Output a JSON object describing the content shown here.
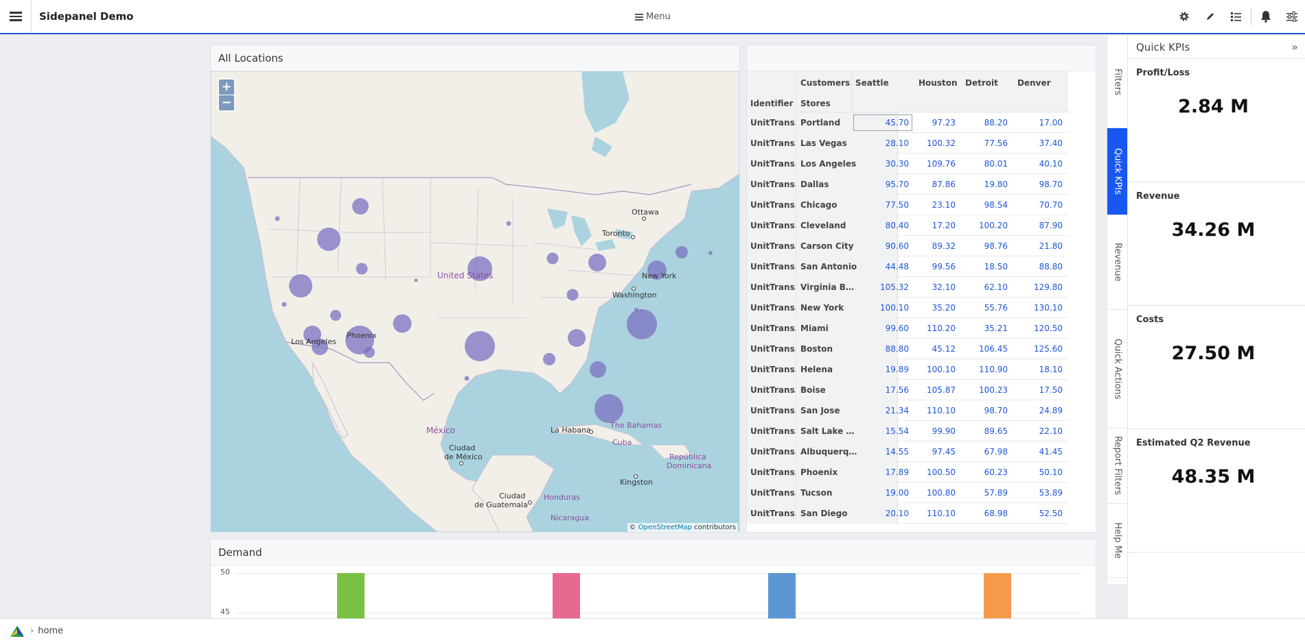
{
  "header": {
    "app_title": "Sidepanel Demo",
    "menu_label": "Menu",
    "icons": [
      "hamburger-icon",
      "gear-icon",
      "pencil-icon",
      "list-icon",
      "bell-icon",
      "sliders-icon"
    ]
  },
  "map_panel": {
    "title": "All Locations",
    "zoom_in": "+",
    "zoom_out": "−",
    "attribution_prefix": "© ",
    "attribution_link": "OpenStreetMap",
    "attribution_suffix": " contributors",
    "labels": {
      "united_states": "United States",
      "mexico": "México",
      "ciudad": "Ciudad",
      "de_mexico": "de México",
      "ottawa": "Ottawa",
      "toronto": "Toronto",
      "washington": "Washington",
      "new_york": "New York",
      "los_angeles": "Los Angeles",
      "phoenix": "Phoenix",
      "la_habana": "La Habana",
      "bahamas": "The Bahamas",
      "cuba": "Cuba",
      "republica": "República",
      "dominicana": "Dominicana",
      "kingston": "Kingston",
      "ciudad2": "Ciudad",
      "guatemala": "de Guatemala",
      "honduras": "Honduras",
      "nicaragua": "Nicaragua"
    }
  },
  "table": {
    "header_row1": "Customers",
    "header_identifier": "Identifier",
    "header_stores": "Stores",
    "columns": [
      "Seattle",
      "Houston",
      "Detroit",
      "Denver"
    ],
    "rows": [
      {
        "id": "UnitTrans…",
        "store": "Portland",
        "values": [
          "45.70",
          "97.23",
          "88.20",
          "17.00"
        ]
      },
      {
        "id": "UnitTrans…",
        "store": "Las Vegas",
        "values": [
          "28.10",
          "100.32",
          "77.56",
          "37.40"
        ]
      },
      {
        "id": "UnitTrans…",
        "store": "Los Angeles",
        "values": [
          "30.30",
          "109.76",
          "80.01",
          "40.10"
        ]
      },
      {
        "id": "UnitTrans…",
        "store": "Dallas",
        "values": [
          "95.70",
          "87.86",
          "19.80",
          "98.70"
        ]
      },
      {
        "id": "UnitTrans…",
        "store": "Chicago",
        "values": [
          "77.50",
          "23.10",
          "98.54",
          "70.70"
        ]
      },
      {
        "id": "UnitTrans…",
        "store": "Cleveland",
        "values": [
          "80.40",
          "17.20",
          "100.20",
          "87.90"
        ]
      },
      {
        "id": "UnitTrans…",
        "store": "Carson City",
        "values": [
          "90.60",
          "89.32",
          "98.76",
          "21.80"
        ]
      },
      {
        "id": "UnitTrans…",
        "store": "San Antonio",
        "values": [
          "44.48",
          "99.56",
          "18.50",
          "88.80"
        ]
      },
      {
        "id": "UnitTrans…",
        "store": "Virginia B…",
        "values": [
          "105.32",
          "32.10",
          "62.10",
          "129.80"
        ]
      },
      {
        "id": "UnitTrans…",
        "store": "New York",
        "values": [
          "100.10",
          "35.20",
          "55.76",
          "130.10"
        ]
      },
      {
        "id": "UnitTrans…",
        "store": "Miami",
        "values": [
          "99.60",
          "110.20",
          "35.21",
          "120.50"
        ]
      },
      {
        "id": "UnitTrans…",
        "store": "Boston",
        "values": [
          "88.80",
          "45.12",
          "106.45",
          "125.60"
        ]
      },
      {
        "id": "UnitTrans…",
        "store": "Helena",
        "values": [
          "19.89",
          "100.10",
          "110.90",
          "18.10"
        ]
      },
      {
        "id": "UnitTrans…",
        "store": "Boise",
        "values": [
          "17.56",
          "105.87",
          "100.23",
          "17.50"
        ]
      },
      {
        "id": "UnitTrans…",
        "store": "San Jose",
        "values": [
          "21.34",
          "110.10",
          "98.70",
          "24.89"
        ]
      },
      {
        "id": "UnitTrans…",
        "store": "Salt Lake …",
        "values": [
          "15.54",
          "99.90",
          "89.65",
          "22.10"
        ]
      },
      {
        "id": "UnitTrans…",
        "store": "Albuquerq…",
        "values": [
          "14.55",
          "97.45",
          "67.98",
          "41.45"
        ]
      },
      {
        "id": "UnitTrans…",
        "store": "Phoenix",
        "values": [
          "17.89",
          "100.50",
          "60.23",
          "50.10"
        ]
      },
      {
        "id": "UnitTrans…",
        "store": "Tucson",
        "values": [
          "19.00",
          "100.80",
          "57.89",
          "53.89"
        ]
      },
      {
        "id": "UnitTrans…",
        "store": "San Diego",
        "values": [
          "20.10",
          "110.10",
          "68.98",
          "52.50"
        ]
      }
    ]
  },
  "demand": {
    "title": "Demand",
    "y_ticks": [
      "50",
      "45"
    ],
    "bar_colors": [
      "#7ac143",
      "#e8698f",
      "#5b97d3",
      "#f59a4d"
    ]
  },
  "side_tabs": [
    {
      "label": "Filters",
      "active": false
    },
    {
      "label": "Quick KPIs",
      "active": true
    },
    {
      "label": "Revenue",
      "active": false
    },
    {
      "label": "Quick Actions",
      "active": false
    },
    {
      "label": "Report Filters",
      "active": false
    },
    {
      "label": "Help Me",
      "active": false
    }
  ],
  "kpi_panel": {
    "title": "Quick KPIs",
    "collapse_icon": "double-chevron-right-icon",
    "cards": [
      {
        "label": "Profit/Loss",
        "value": "2.84 M"
      },
      {
        "label": "Revenue",
        "value": "34.26 M"
      },
      {
        "label": "Costs",
        "value": "27.50 M"
      },
      {
        "label": "Estimated Q2 Revenue",
        "value": "48.35 M"
      }
    ]
  },
  "footer": {
    "breadcrumb_home": "home"
  },
  "colors": {
    "accent": "#2155d6",
    "active_tab": "#1857f0",
    "value_text": "#1c55d8",
    "bubble": "#7b72c0"
  }
}
